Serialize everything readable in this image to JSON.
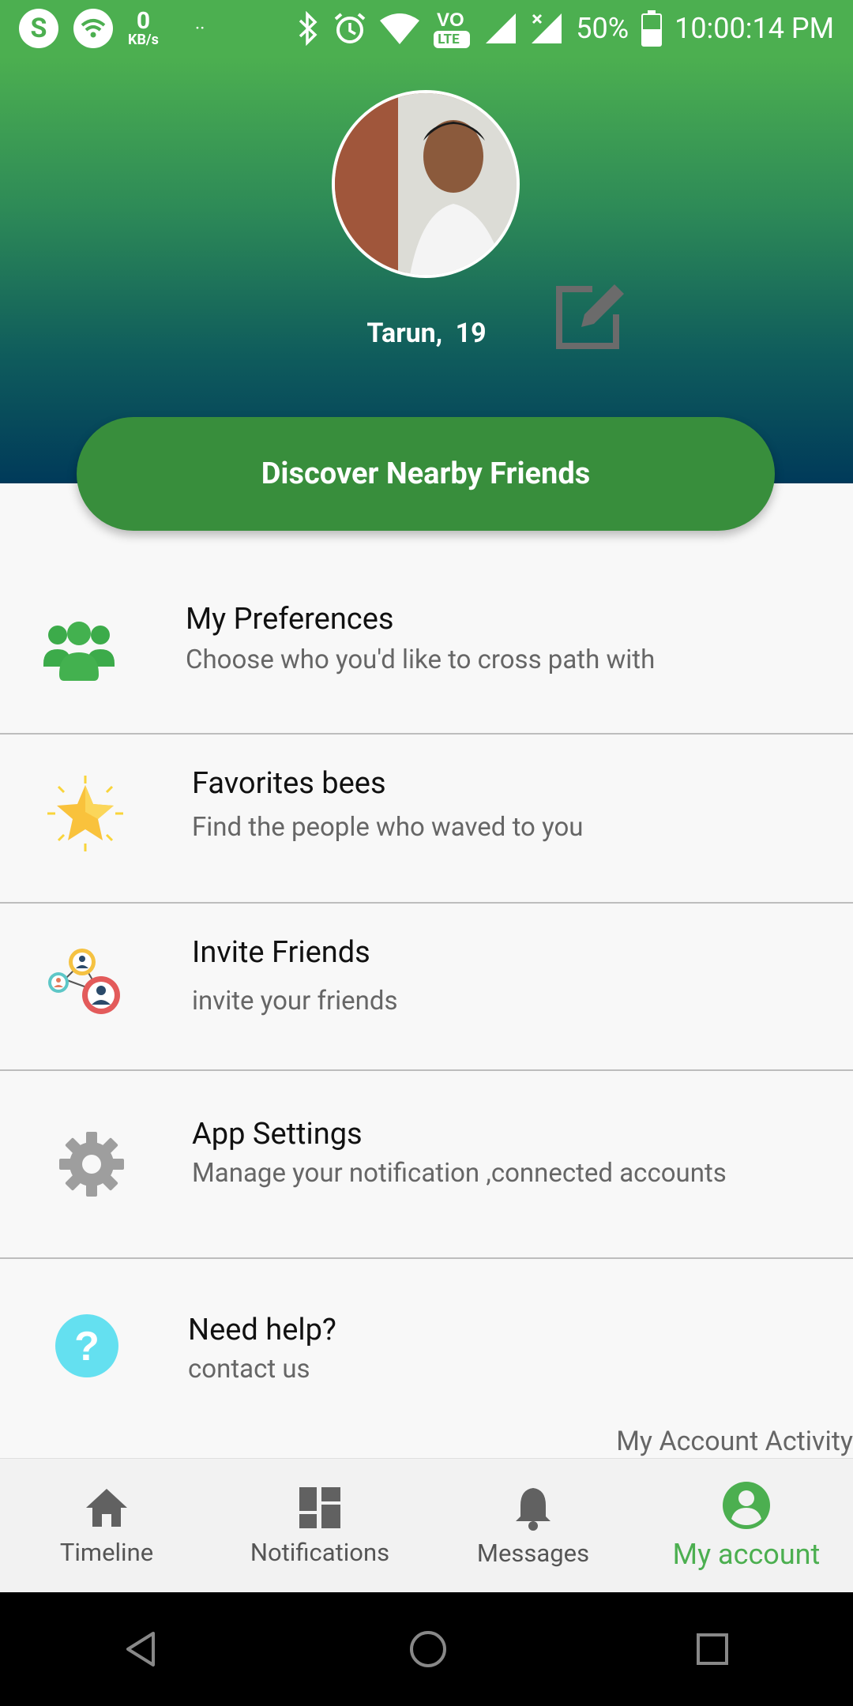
{
  "status_bar": {
    "skype": "S",
    "speed_value": "0",
    "speed_unit": "KB/s",
    "dots": "··",
    "battery": "50%",
    "time": "10:00:14 PM",
    "lte": "LTE"
  },
  "profile": {
    "name": "Tarun,",
    "age": "19"
  },
  "discover_label": "Discover Nearby Friends",
  "menu": [
    {
      "title": "My Preferences",
      "subtitle": "Choose who you'd like to cross path with",
      "icon": "group-icon"
    },
    {
      "title": "Favorites bees",
      "subtitle": "Find the people who waved to you",
      "icon": "star-icon"
    },
    {
      "title": "Invite Friends",
      "subtitle": "invite your friends",
      "icon": "invite-friends-icon"
    },
    {
      "title": "App Settings",
      "subtitle": "Manage your notification ,connected accounts",
      "icon": "gear-icon"
    },
    {
      "title": "Need help?",
      "subtitle": "contact us",
      "icon": "help-icon"
    }
  ],
  "account_activity": "My Account Activity",
  "bottom_nav": [
    {
      "label": "Timeline",
      "icon": "home-icon"
    },
    {
      "label": "Notifications",
      "icon": "dashboard-icon"
    },
    {
      "label": "Messages",
      "icon": "bell-icon"
    },
    {
      "label": "My account",
      "icon": "account-icon",
      "active": true
    }
  ],
  "colors": {
    "primary": "#4caf50",
    "button": "#388e3c",
    "header_bottom": "#003a5a"
  }
}
